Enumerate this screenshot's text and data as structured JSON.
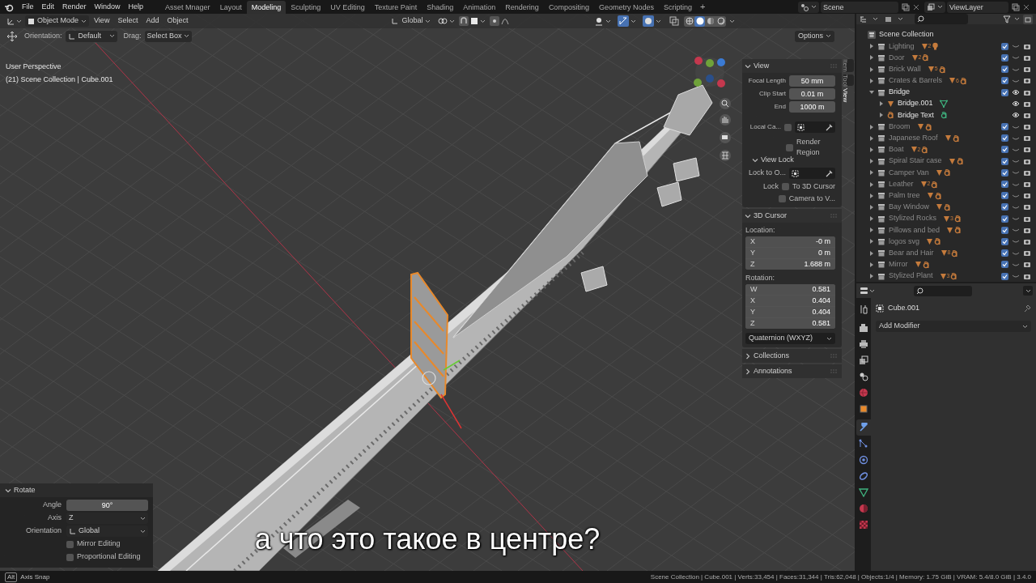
{
  "top_bar": {
    "menus": [
      "File",
      "Edit",
      "Render",
      "Window",
      "Help"
    ],
    "workspaces": [
      {
        "label": "Asset Mnager",
        "selected": false
      },
      {
        "label": "Layout",
        "selected": false
      },
      {
        "label": "Modeling",
        "selected": true
      },
      {
        "label": "Sculpting",
        "selected": false
      },
      {
        "label": "UV Editing",
        "selected": false
      },
      {
        "label": "Texture Paint",
        "selected": false
      },
      {
        "label": "Shading",
        "selected": false
      },
      {
        "label": "Animation",
        "selected": false
      },
      {
        "label": "Rendering",
        "selected": false
      },
      {
        "label": "Compositing",
        "selected": false
      },
      {
        "label": "Geometry Nodes",
        "selected": false
      },
      {
        "label": "Scripting",
        "selected": false
      }
    ],
    "add_tab": "+",
    "scene": "Scene",
    "view_layer": "ViewLayer"
  },
  "viewport": {
    "mode": "Object Mode",
    "menus": [
      "View",
      "Select",
      "Add",
      "Object"
    ],
    "orientation": "Global",
    "options": "Options",
    "tool_settings": {
      "orientation_label": "Orientation:",
      "orientation": "Default",
      "drag_label": "Drag:",
      "drag": "Select Box"
    },
    "shading_modes": [
      {
        "kind": "wireframe",
        "selected": false
      },
      {
        "kind": "solid",
        "selected": true
      },
      {
        "kind": "material",
        "selected": false
      },
      {
        "kind": "rendered",
        "selected": false
      }
    ],
    "view_name": "User Perspective",
    "context": "(21) Scene Collection | Cube.001",
    "subtitle": "а что это такое в центре?"
  },
  "sidebar": {
    "tabs": [
      {
        "label": "Item",
        "selected": false
      },
      {
        "label": "Tool",
        "selected": false
      },
      {
        "label": "View",
        "selected": true
      }
    ],
    "view": {
      "title": "View",
      "expanded": true,
      "fields": [
        {
          "label": "Focal Length",
          "value": "50 mm"
        },
        {
          "label": "Clip Start",
          "value": "0.01 m"
        },
        {
          "label": "End",
          "value": "1000 m"
        }
      ],
      "local_camera": {
        "label": "Local Ca...",
        "checked": false
      },
      "render_region": {
        "label": "Render Region",
        "checked": false
      },
      "view_lock": {
        "title": "View Lock",
        "expanded": true,
        "lock_object_label": "Lock to O...",
        "lock_label": "Lock",
        "options": [
          {
            "label": "To 3D Cursor",
            "checked": false
          },
          {
            "label": "Camera to V...",
            "checked": false
          }
        ]
      }
    },
    "cursor": {
      "title": "3D Cursor",
      "expanded": true,
      "location_label": "Location:",
      "location": [
        {
          "axis": "X",
          "value": "-0 m"
        },
        {
          "axis": "Y",
          "value": "0 m"
        },
        {
          "axis": "Z",
          "value": "1.688 m"
        }
      ],
      "rotation_label": "Rotation:",
      "rotation": [
        {
          "axis": "W",
          "value": "0.581"
        },
        {
          "axis": "X",
          "value": "0.404"
        },
        {
          "axis": "Y",
          "value": "0.404"
        },
        {
          "axis": "Z",
          "value": "0.581"
        }
      ],
      "rotation_mode": "Quaternion (WXYZ)"
    },
    "collapsed_panels": [
      {
        "title": "Collections",
        "expanded": false
      },
      {
        "title": "Annotations",
        "expanded": false
      }
    ]
  },
  "operator": {
    "title": "Rotate",
    "expanded": true,
    "fields": [
      {
        "label": "Angle",
        "value": "90°",
        "kind": "number"
      },
      {
        "label": "Axis",
        "value": "Z",
        "kind": "dropdown"
      },
      {
        "label": "Orientation",
        "value": "Global",
        "kind": "dropdown"
      }
    ],
    "options": [
      {
        "label": "Mirror Editing",
        "checked": false
      },
      {
        "label": "Proportional Editing",
        "checked": false
      }
    ]
  },
  "outliner": {
    "root": "Scene Collection",
    "items": [
      {
        "name": "Lighting",
        "kind": "collection",
        "expanded": false,
        "checked": true,
        "visible": false,
        "contents": [
          {
            "kind": "mesh",
            "count": "2"
          },
          {
            "kind": "light"
          }
        ]
      },
      {
        "name": "Door",
        "kind": "collection",
        "expanded": false,
        "checked": true,
        "visible": false,
        "contents": [
          {
            "kind": "mesh",
            "count": "2"
          },
          {
            "kind": "text"
          }
        ]
      },
      {
        "name": "Brick Wall",
        "kind": "collection",
        "expanded": false,
        "checked": true,
        "visible": false,
        "contents": [
          {
            "kind": "mesh",
            "count": "5"
          },
          {
            "kind": "text"
          }
        ]
      },
      {
        "name": "Crates & Barrels",
        "kind": "collection",
        "expanded": false,
        "checked": true,
        "visible": false,
        "contents": [
          {
            "kind": "mesh",
            "count": "6"
          },
          {
            "kind": "text"
          }
        ]
      },
      {
        "name": "Bridge",
        "kind": "collection",
        "expanded": true,
        "checked": true,
        "visible": true,
        "children": [
          {
            "name": "Bridge.001",
            "kind": "mesh",
            "expanded": false,
            "visible": true,
            "contents": [
              {
                "kind": "mesh_data"
              }
            ]
          },
          {
            "name": "Bridge Text",
            "kind": "text",
            "expanded": false,
            "visible": true,
            "contents": [
              {
                "kind": "text_data"
              }
            ]
          }
        ]
      },
      {
        "name": "Broom",
        "kind": "collection",
        "expanded": false,
        "checked": true,
        "visible": false,
        "contents": [
          {
            "kind": "mesh"
          },
          {
            "kind": "text"
          }
        ]
      },
      {
        "name": "Japanese Roof",
        "kind": "collection",
        "expanded": false,
        "checked": true,
        "visible": false,
        "contents": [
          {
            "kind": "mesh"
          },
          {
            "kind": "text"
          }
        ]
      },
      {
        "name": "Boat",
        "kind": "collection",
        "expanded": false,
        "checked": true,
        "visible": false,
        "contents": [
          {
            "kind": "mesh",
            "count": "2"
          },
          {
            "kind": "text"
          }
        ]
      },
      {
        "name": "Spiral Stair case",
        "kind": "collection",
        "expanded": false,
        "checked": true,
        "visible": false,
        "contents": [
          {
            "kind": "mesh"
          },
          {
            "kind": "text"
          }
        ]
      },
      {
        "name": "Camper Van",
        "kind": "collection",
        "expanded": false,
        "checked": true,
        "visible": false,
        "contents": [
          {
            "kind": "mesh"
          },
          {
            "kind": "text"
          }
        ]
      },
      {
        "name": "Leather",
        "kind": "collection",
        "expanded": false,
        "checked": true,
        "visible": false,
        "contents": [
          {
            "kind": "mesh",
            "count": "2"
          },
          {
            "kind": "text"
          }
        ]
      },
      {
        "name": "Palm tree",
        "kind": "collection",
        "expanded": false,
        "checked": true,
        "visible": false,
        "contents": [
          {
            "kind": "mesh"
          },
          {
            "kind": "text"
          }
        ]
      },
      {
        "name": "Bay Window",
        "kind": "collection",
        "expanded": false,
        "checked": true,
        "visible": false,
        "contents": [
          {
            "kind": "mesh"
          },
          {
            "kind": "text"
          }
        ]
      },
      {
        "name": "Stylized Rocks",
        "kind": "collection",
        "expanded": false,
        "checked": true,
        "visible": false,
        "contents": [
          {
            "kind": "mesh",
            "count": "3"
          },
          {
            "kind": "text"
          }
        ]
      },
      {
        "name": "Pillows and bed",
        "kind": "collection",
        "expanded": false,
        "checked": true,
        "visible": false,
        "contents": [
          {
            "kind": "mesh"
          },
          {
            "kind": "text"
          }
        ]
      },
      {
        "name": "logos svg",
        "kind": "collection",
        "expanded": false,
        "checked": true,
        "visible": false,
        "contents": [
          {
            "kind": "mesh"
          },
          {
            "kind": "text"
          }
        ]
      },
      {
        "name": "Bear and Hair",
        "kind": "collection",
        "expanded": false,
        "checked": true,
        "visible": false,
        "contents": [
          {
            "kind": "mesh",
            "count": "8"
          },
          {
            "kind": "text"
          }
        ]
      },
      {
        "name": "Mirror",
        "kind": "collection",
        "expanded": false,
        "checked": true,
        "visible": false,
        "contents": [
          {
            "kind": "mesh"
          },
          {
            "kind": "text"
          }
        ]
      },
      {
        "name": "Stylized Plant",
        "kind": "collection",
        "expanded": false,
        "checked": true,
        "visible": false,
        "contents": [
          {
            "kind": "mesh",
            "count": "3"
          },
          {
            "kind": "text"
          }
        ]
      }
    ]
  },
  "properties": {
    "object_name": "Cube.001",
    "add_modifier": "Add Modifier",
    "tabs": [
      {
        "kind": "tool",
        "selected": false
      },
      {
        "kind": "render",
        "selected": false
      },
      {
        "kind": "output",
        "selected": false
      },
      {
        "kind": "view_layer",
        "selected": false
      },
      {
        "kind": "scene",
        "selected": false
      },
      {
        "kind": "world",
        "selected": false
      },
      {
        "kind": "object",
        "selected": false
      },
      {
        "kind": "modifiers",
        "selected": true
      },
      {
        "kind": "particles",
        "selected": false
      },
      {
        "kind": "physics",
        "selected": false
      },
      {
        "kind": "constraints",
        "selected": false
      },
      {
        "kind": "data",
        "selected": false
      },
      {
        "kind": "material",
        "selected": false
      },
      {
        "kind": "texture",
        "selected": false
      }
    ]
  },
  "status_bar": {
    "key": "Alt",
    "hint": "Axis Snap",
    "stats": "Scene Collection | Cube.001 | Verts:33,454 | Faces:31,344 | Tris:62,048 | Objects:1/4 | Memory: 1.75 GiB | VRAM: 5.4/8.0 GiB | 3.4.0"
  }
}
